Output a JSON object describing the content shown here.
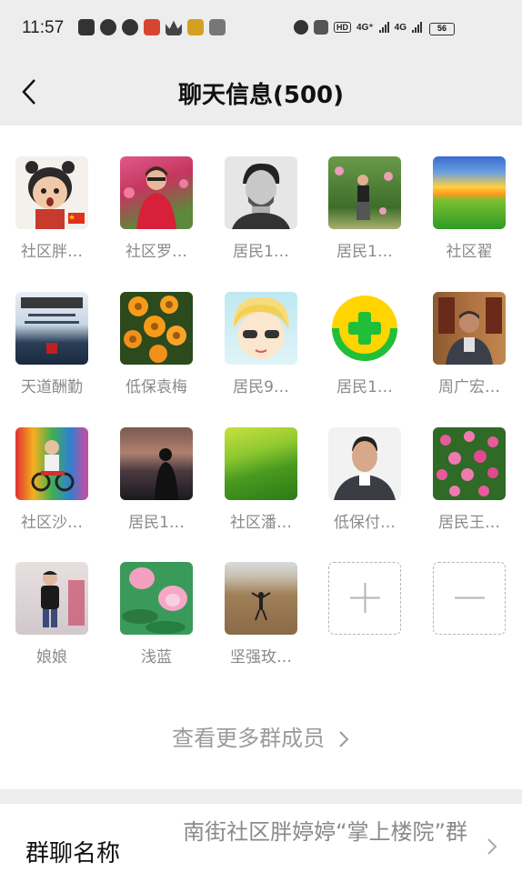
{
  "status_bar": {
    "time": "11:57",
    "network_1": "4G⁺",
    "network_2": "4G",
    "hd_label": "HD",
    "battery": "56"
  },
  "header": {
    "title": "聊天信息(500)"
  },
  "members": [
    {
      "name": "社区胖…",
      "avatar": "cartoon-child"
    },
    {
      "name": "社区罗…",
      "avatar": "woman-flowers"
    },
    {
      "name": "居民1…",
      "avatar": "man-portrait-bw"
    },
    {
      "name": "居民1…",
      "avatar": "woman-garden"
    },
    {
      "name": "社区翟",
      "avatar": "sunset-field"
    },
    {
      "name": "天道酬勤",
      "avatar": "calligraphy"
    },
    {
      "name": "低保袁梅",
      "avatar": "orange-flowers"
    },
    {
      "name": "居民9…",
      "avatar": "cartoon-girl"
    },
    {
      "name": "居民1…",
      "avatar": "green-plus-logo"
    },
    {
      "name": "周广宏…",
      "avatar": "older-man"
    },
    {
      "name": "社区沙…",
      "avatar": "child-bike"
    },
    {
      "name": "居民1…",
      "avatar": "silhouette-sunset"
    },
    {
      "name": "社区潘…",
      "avatar": "green-hills"
    },
    {
      "name": "低保付…",
      "avatar": "man-portrait"
    },
    {
      "name": "居民王…",
      "avatar": "pink-flowers"
    },
    {
      "name": "娘娘",
      "avatar": "child-standing"
    },
    {
      "name": "浅蓝",
      "avatar": "lotus"
    },
    {
      "name": "坚强玫…",
      "avatar": "person-hill"
    }
  ],
  "view_more": {
    "label": "查看更多群成员"
  },
  "group_name": {
    "label": "群聊名称",
    "value": "南街社区胖婷婷“掌上楼院”群"
  },
  "colors": {
    "header_bg": "#ededed",
    "green_accent": "#1fbf3a",
    "muted_text": "#8a8a8a"
  }
}
